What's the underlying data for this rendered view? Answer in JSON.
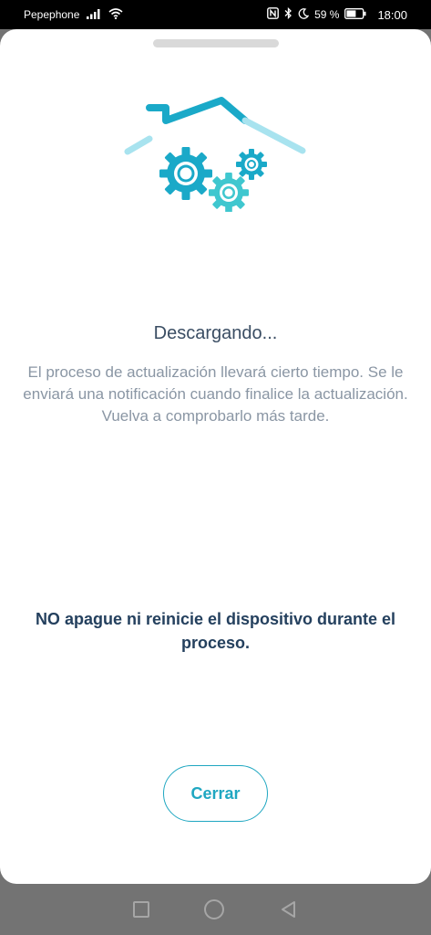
{
  "status_bar": {
    "carrier": "Pepephone",
    "battery_percent": "59 %",
    "time": "18:00"
  },
  "dialog": {
    "title": "Descargando...",
    "body": "El proceso de actualización llevará cierto tiempo. Se le enviará una notificación cuando finalice la actualización. Vuelva a comprobarlo más tarde.",
    "warning": "NO apague ni reinicie el dispositivo durante el proceso.",
    "close_label": "Cerrar"
  },
  "colors": {
    "accent": "#1fa7c1",
    "title": "#3a4d63",
    "body": "#8a96a4",
    "warning": "#24405e"
  },
  "icons": [
    "signal-icon",
    "wifi-icon",
    "nfc-icon",
    "bluetooth-icon",
    "moon-icon",
    "battery-icon",
    "house-gears-icon"
  ]
}
